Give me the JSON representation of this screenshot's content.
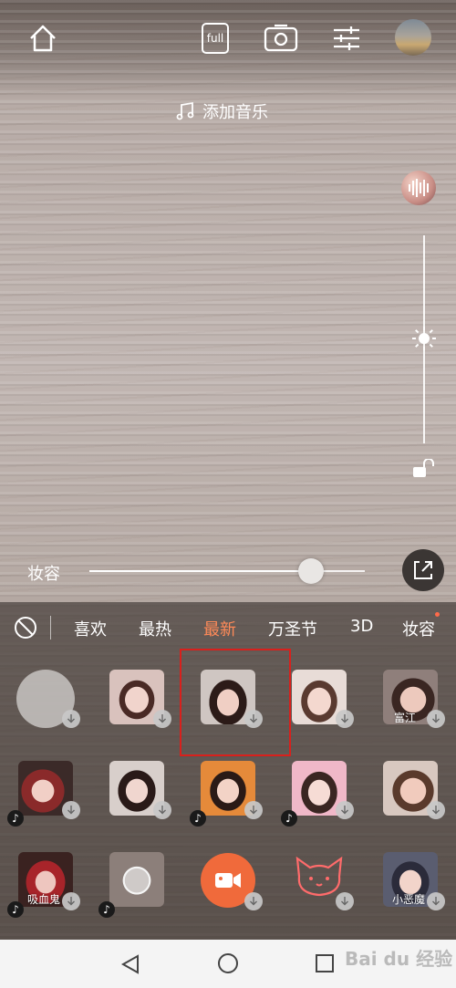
{
  "top_bar": {
    "home_icon": "home-icon",
    "full_label": "full",
    "flip_icon": "camera-flip-icon",
    "settings_icon": "sliders-icon",
    "avatar_icon": "gallery-thumbnail"
  },
  "music": {
    "label": "添加音乐",
    "icon": "music-note-icon"
  },
  "side": {
    "brightness_icon": "sun-icon",
    "lock_icon": "unlock-icon"
  },
  "makeup_slider": {
    "label": "妆容",
    "value": 0.8
  },
  "tabs": [
    {
      "label": "喜欢",
      "active": false
    },
    {
      "label": "最热",
      "active": false
    },
    {
      "label": "最新",
      "active": true
    },
    {
      "label": "万圣节",
      "active": false
    },
    {
      "label": "3D",
      "active": false
    },
    {
      "label": "妆容",
      "active": false
    }
  ],
  "colors": {
    "active_tab": "#ff8a58",
    "selection_border": "#d9201c",
    "record_button": "#f06a3b"
  },
  "stickers": [
    {
      "label": "",
      "kind": "none"
    },
    {
      "label": ""
    },
    {
      "label": "",
      "selected": true
    },
    {
      "label": ""
    },
    {
      "label": "富江"
    },
    {
      "label": ""
    },
    {
      "label": ""
    },
    {
      "label": ""
    },
    {
      "label": ""
    },
    {
      "label": ""
    },
    {
      "label": "吸血鬼"
    },
    {
      "label": ""
    },
    {
      "label": "",
      "kind": "record"
    },
    {
      "label": "",
      "kind": "cat"
    },
    {
      "label": "小恶魔"
    }
  ],
  "navbar": {
    "back_icon": "back-triangle-icon",
    "home_icon": "home-circle-icon",
    "recents_icon": "recents-square-icon"
  },
  "watermark": {
    "text": "Bai du 经验"
  }
}
